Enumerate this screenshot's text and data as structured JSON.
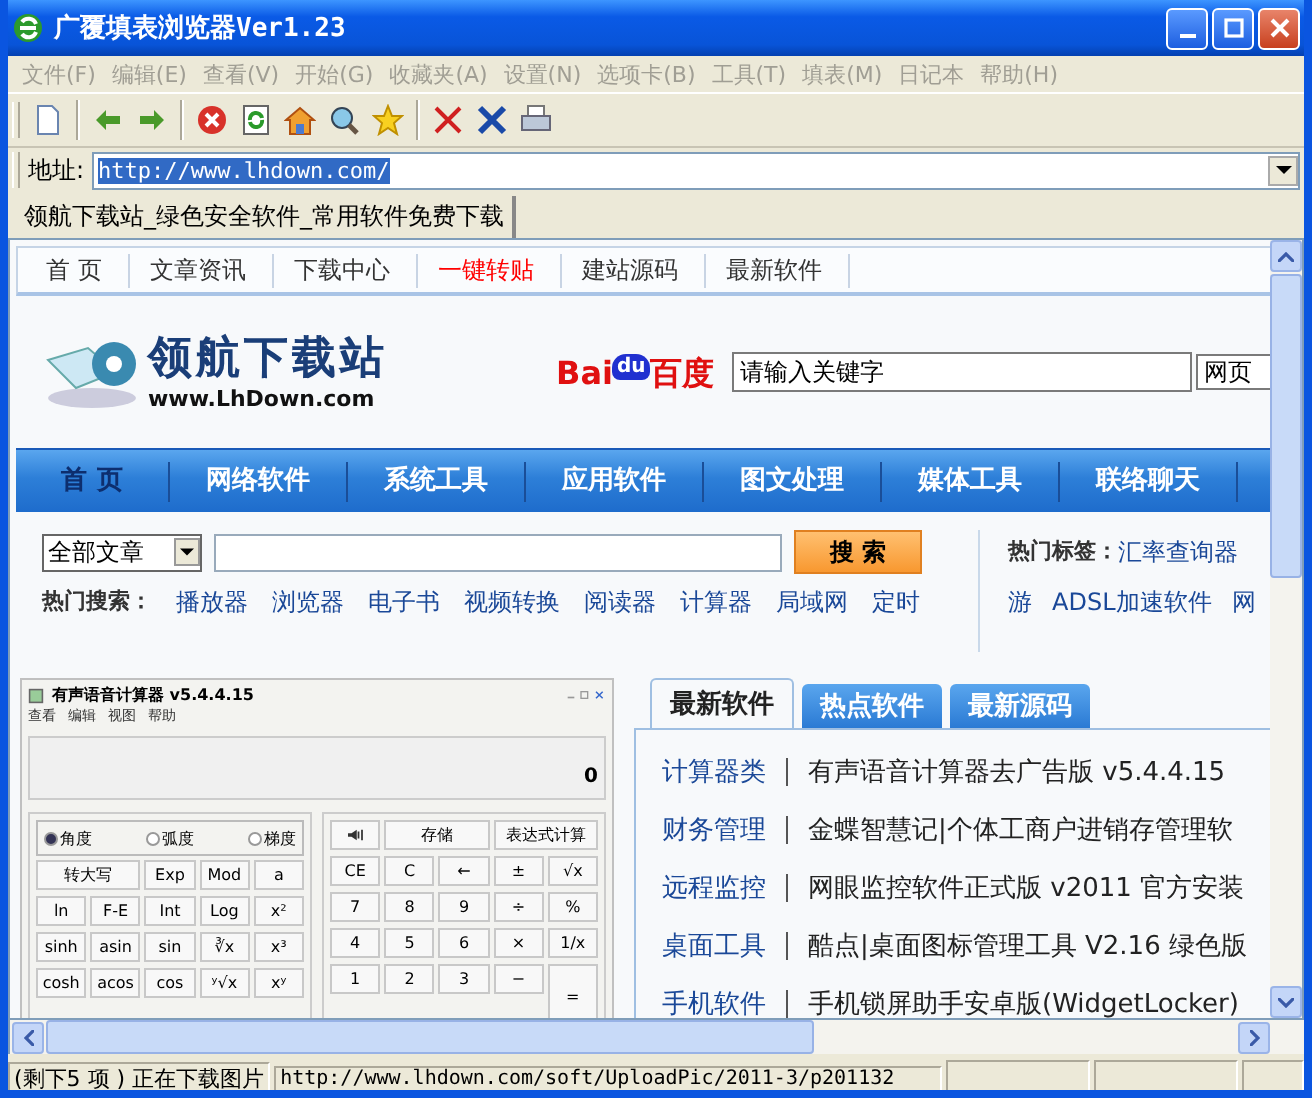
{
  "window": {
    "title": "广覆填表浏览器Ver1.23"
  },
  "menu": [
    "文件(F)",
    "编辑(E)",
    "查看(V)",
    "开始(G)",
    "收藏夹(A)",
    "设置(N)",
    "选项卡(B)",
    "工具(T)",
    "填表(M)",
    "日记本",
    "帮助(H)"
  ],
  "address": {
    "label": "地址:",
    "value": "http://www.lhdown.com/"
  },
  "tabs": [
    {
      "label": "领航下载站_绿色安全软件_常用软件免费下载",
      "selected": true
    }
  ],
  "page": {
    "nav_links": [
      {
        "label": "首 页",
        "color": "#333333"
      },
      {
        "label": "文章资讯",
        "color": "#333333"
      },
      {
        "label": "下载中心",
        "color": "#333333"
      },
      {
        "label": "一键转贴",
        "color": "#ff0000"
      },
      {
        "label": "建站源码",
        "color": "#333333"
      },
      {
        "label": "最新软件",
        "color": "#333333"
      }
    ],
    "logo": {
      "title": "领航下载站",
      "url": "www.LhDown.com"
    },
    "baidu": {
      "left": "Bai",
      "paw": "du",
      "right": "百度"
    },
    "web_search": {
      "value": "请输入关键字",
      "engine": "网页"
    },
    "categories": [
      {
        "label": "首 页",
        "selected": true
      },
      {
        "label": "网络软件",
        "selected": false
      },
      {
        "label": "系统工具",
        "selected": false
      },
      {
        "label": "应用软件",
        "selected": false
      },
      {
        "label": "图文处理",
        "selected": false
      },
      {
        "label": "媒体工具",
        "selected": false
      },
      {
        "label": "联络聊天",
        "selected": false
      }
    ],
    "site_search": {
      "scope": "全部文章",
      "button": "搜 索",
      "hot_label": "热门搜索：",
      "hot_terms": [
        "播放器",
        "浏览器",
        "电子书",
        "视频转换",
        "阅读器",
        "计算器",
        "局域网",
        "定时"
      ]
    },
    "hot_tags": {
      "label": "热门标签：",
      "first_line": [
        "汇率查询器"
      ],
      "second_line": [
        "游",
        "ADSL加速软件",
        "网"
      ]
    },
    "calculator": {
      "title": "有声语音计算器 v5.4.4.15",
      "menu": [
        "查看",
        "编辑",
        "视图",
        "帮助"
      ],
      "display": "0",
      "angle_modes": [
        {
          "label": "角度",
          "selected": true
        },
        {
          "label": "弧度",
          "selected": false
        },
        {
          "label": "梯度",
          "selected": false
        }
      ],
      "left_keys": [
        {
          "label": "转大写",
          "kind": "wide"
        },
        {
          "label": "Exp",
          "kind": "key"
        },
        {
          "label": "Mod",
          "kind": "key"
        },
        {
          "label": "a",
          "kind": "key"
        },
        {
          "label": "ln",
          "kind": "key"
        },
        {
          "label": "F-E",
          "kind": "key"
        },
        {
          "label": "Int",
          "kind": "key"
        },
        {
          "label": "Log",
          "kind": "key"
        },
        {
          "label": "x²",
          "kind": "key"
        },
        {
          "label": "sinh",
          "kind": "key"
        },
        {
          "label": "asin",
          "kind": "key"
        },
        {
          "label": "sin",
          "kind": "key"
        },
        {
          "label": "∛x",
          "kind": "key"
        },
        {
          "label": "x³",
          "kind": "key"
        },
        {
          "label": "cosh",
          "kind": "key"
        },
        {
          "label": "acos",
          "kind": "key"
        },
        {
          "label": "cos",
          "kind": "key"
        },
        {
          "label": "ʸ√x",
          "kind": "key"
        },
        {
          "label": "xʸ",
          "kind": "key"
        }
      ],
      "right_keys": [
        {
          "kind": "sound"
        },
        {
          "label": "存储",
          "kind": "wide"
        },
        {
          "label": "表达式计算",
          "kind": "wide"
        },
        {
          "label": "CE",
          "kind": "key"
        },
        {
          "label": "C",
          "kind": "key"
        },
        {
          "label": "←",
          "kind": "key"
        },
        {
          "label": "±",
          "kind": "key"
        },
        {
          "label": "√x",
          "kind": "key"
        },
        {
          "label": "7",
          "kind": "key"
        },
        {
          "label": "8",
          "kind": "key"
        },
        {
          "label": "9",
          "kind": "key"
        },
        {
          "label": "÷",
          "kind": "key"
        },
        {
          "label": "%",
          "kind": "key"
        },
        {
          "label": "4",
          "kind": "key"
        },
        {
          "label": "5",
          "kind": "key"
        },
        {
          "label": "6",
          "kind": "key"
        },
        {
          "label": "×",
          "kind": "key"
        },
        {
          "label": "1/x",
          "kind": "key"
        },
        {
          "label": "1",
          "kind": "key"
        },
        {
          "label": "2",
          "kind": "key"
        },
        {
          "label": "3",
          "kind": "key"
        },
        {
          "label": "−",
          "kind": "key"
        },
        {
          "label": "=",
          "kind": "tall"
        }
      ]
    },
    "software_tabs": [
      {
        "label": "最新软件",
        "selected": true
      },
      {
        "label": "热点软件",
        "selected": false
      },
      {
        "label": "最新源码",
        "selected": false
      }
    ],
    "software_list": [
      {
        "category": "计算器类",
        "title": "有声语音计算器去广告版 v5.4.4.15"
      },
      {
        "category": "财务管理",
        "title": "金蝶智慧记|个体工商户进销存管理软"
      },
      {
        "category": "远程监控",
        "title": "网眼监控软件正式版 v2011 官方安装"
      },
      {
        "category": "桌面工具",
        "title": "酷点|桌面图标管理工具 V2.16 绿色版"
      },
      {
        "category": "手机软件",
        "title": "手机锁屏助手安卓版(WidgetLocker)"
      }
    ]
  },
  "status_bar": {
    "text": "(剩下5 项 ) 正在下载图片",
    "url": "http://www.lhdown.com/soft/UploadPic/2011-3/p201132"
  }
}
